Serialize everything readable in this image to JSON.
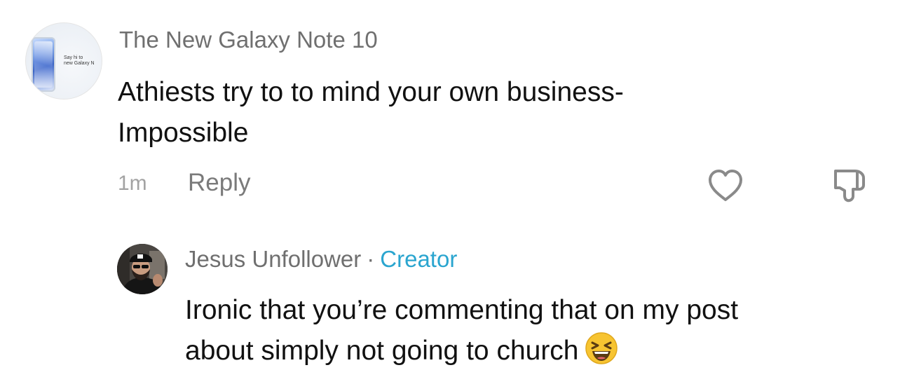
{
  "comment": {
    "avatar_tagline": "Say hi to\nnew Galaxy N",
    "username": "The New Galaxy Note 10",
    "text_line1": "Athiests try to to mind your own business-",
    "text_line2": "Impossible",
    "time": "1m",
    "reply_label": "Reply",
    "like_icon": "heart-icon",
    "dislike_icon": "thumbs-down-icon"
  },
  "reply": {
    "username": "Jesus Unfollower",
    "separator": "·",
    "creator_badge": "Creator",
    "text_line1": "Ironic that you’re commenting that on my post",
    "text_line2": "about simply not going to church",
    "emoji_icon": "grinning-squinting-face-icon"
  },
  "colors": {
    "username": "#6f6f6f",
    "body_text": "#111111",
    "creator_badge": "#2aa5cf",
    "meta": "#a3a3a3",
    "reply_button": "#7a7a7a"
  }
}
